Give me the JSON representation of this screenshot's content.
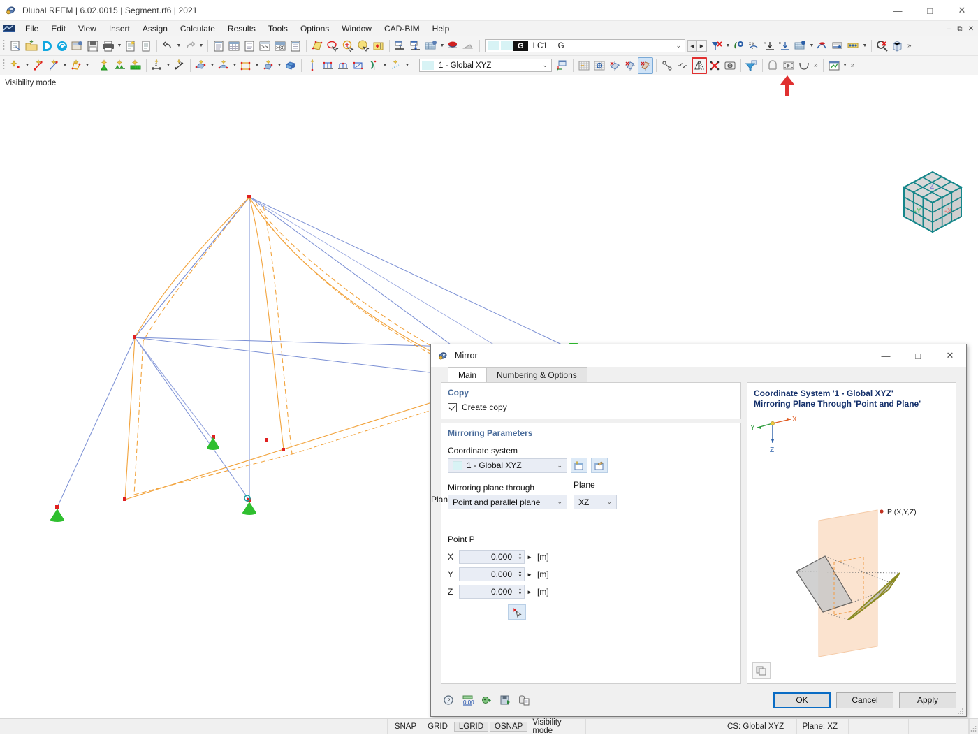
{
  "window": {
    "title": "Dlubal RFEM | 6.02.0015 | Segment.rf6 | 2021",
    "app_icon": "rfem-logo-icon",
    "controls": {
      "minimize": "—",
      "maximize": "□",
      "close": "✕"
    },
    "mdi_controls": {
      "minimize": "–",
      "restore": "❐",
      "close": "✕"
    }
  },
  "menubar": {
    "logo": "rfem-menu-logo-icon",
    "items": [
      {
        "label": "File"
      },
      {
        "label": "Edit"
      },
      {
        "label": "View"
      },
      {
        "label": "Insert"
      },
      {
        "label": "Assign"
      },
      {
        "label": "Calculate"
      },
      {
        "label": "Results"
      },
      {
        "label": "Tools"
      },
      {
        "label": "Options"
      },
      {
        "label": "Window"
      },
      {
        "label": "CAD-BIM"
      },
      {
        "label": "Help"
      }
    ]
  },
  "toolbar_top": {
    "load_case_combo": {
      "tag": "G",
      "code": "LC1",
      "name": "G",
      "arrow": "⌄"
    },
    "nav_prev": "◀",
    "nav_next": "▶"
  },
  "toolbar_second": {
    "coordinate_system_combo": {
      "value": "1 - Global XYZ",
      "arrow": "⌄"
    },
    "mirror_button_name": "mirror-tool-button",
    "mirror_highlight_color": "#e03030",
    "overflow": "»"
  },
  "viewport": {
    "mode_label": "Visibility mode",
    "nav_cube": {
      "label_x": "-X",
      "label_y": "-Y",
      "label_z": "Z"
    },
    "colors": {
      "member_line": "#7a8fd4",
      "deformation_line": "#f2a33c",
      "node": "#e02020",
      "support": "#2fbf2f"
    }
  },
  "dialog": {
    "title": "Mirror",
    "icon": "mirror-dialog-icon",
    "controls": {
      "minimize": "—",
      "maximize": "□",
      "close": "✕"
    },
    "tabs": [
      {
        "label": "Main",
        "active": true
      },
      {
        "label": "Numbering & Options",
        "active": false
      }
    ],
    "copy_section": {
      "heading": "Copy",
      "create_copy_label": "Create copy",
      "create_copy_checked": true
    },
    "mirroring_section": {
      "heading": "Mirroring Parameters",
      "coordinate_system_label": "Coordinate system",
      "coordinate_system_value": "1 - Global XYZ",
      "new_cs_button": "new-coordinate-system-button",
      "edit_cs_button": "edit-coordinate-system-button",
      "plane_through_label": "Mirroring plane through",
      "plane_through_value": "Point and parallel plane",
      "plane_label": "Plane",
      "plane_value": "XZ",
      "point_heading": "Point P",
      "coords": [
        {
          "axis": "X",
          "value": "0.000",
          "unit": "[m]"
        },
        {
          "axis": "Y",
          "value": "0.000",
          "unit": "[m]"
        },
        {
          "axis": "Z",
          "value": "0.000",
          "unit": "[m]"
        }
      ],
      "pick_point_button": "pick-point-in-viewport-button"
    },
    "preview": {
      "line1": "Coordinate System '1 - Global XYZ'",
      "line2": "Mirroring Plane Through 'Point and Plane'",
      "axis_x": "X",
      "axis_y": "Y",
      "axis_z": "Z",
      "point_label": "P (X,Y,Z)",
      "snapshot_button": "preview-snapshot-button",
      "plane_fill": "#fbe3cf",
      "original_fill": "#c9c9c9",
      "mirrored_outline": "#8a8a20"
    },
    "footer": {
      "icons": [
        {
          "name": "help-button"
        },
        {
          "name": "units-decimal-places-button"
        },
        {
          "name": "import-settings-button"
        },
        {
          "name": "save-settings-button"
        },
        {
          "name": "default-settings-button"
        }
      ],
      "ok_label": "OK",
      "cancel_label": "Cancel",
      "apply_label": "Apply"
    }
  },
  "statusbar": {
    "toggles": [
      {
        "label": "SNAP",
        "on": false
      },
      {
        "label": "GRID",
        "on": false
      },
      {
        "label": "LGRID",
        "on": true
      },
      {
        "label": "OSNAP",
        "on": true
      }
    ],
    "mode": "Visibility mode",
    "cs": "CS: Global XYZ",
    "plane": "Plane: XZ"
  }
}
